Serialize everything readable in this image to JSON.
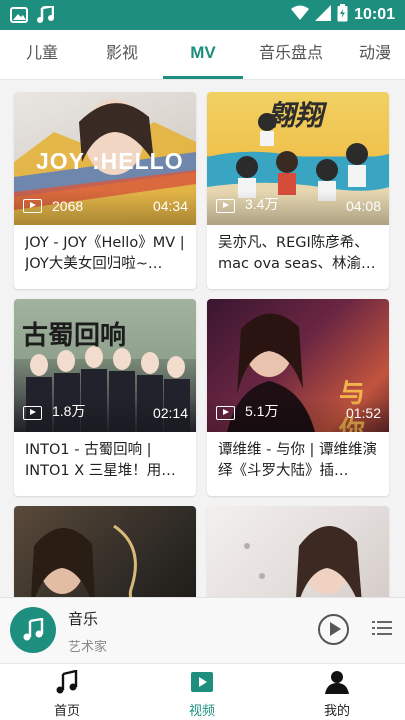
{
  "status_bar": {
    "time": "10:01"
  },
  "tabs": [
    {
      "label": "儿童"
    },
    {
      "label": "影视"
    },
    {
      "label": "MV"
    },
    {
      "label": "音乐盘点"
    },
    {
      "label": "动漫"
    }
  ],
  "active_tab": "MV",
  "videos": [
    {
      "views": "2068",
      "duration": "04:34",
      "title": "JOY - JOY《Hello》MV | JOY大美女回归啦~…",
      "thumb_text": "JOY :HELLO"
    },
    {
      "views": "3.4万",
      "duration": "04:08",
      "title": "吴亦凡、REGI陈彦希、mac ova seas、林渝…",
      "thumb_text": "翱翔"
    },
    {
      "views": "1.8万",
      "duration": "02:14",
      "title": "INTO1 - 古蜀回响 | INTO1 X 三星堆！用…",
      "thumb_text": "古蜀回响"
    },
    {
      "views": "5.1万",
      "duration": "01:52",
      "title": "谭维维 - 与你 | 谭维维演绎《斗罗大陆》插…",
      "thumb_text": "与你"
    },
    {
      "views": "",
      "duration": "",
      "title": "",
      "thumb_text": ""
    },
    {
      "views": "",
      "duration": "",
      "title": "",
      "thumb_text": ""
    }
  ],
  "player": {
    "title": "音乐",
    "artist": "艺术家"
  },
  "bottom_nav": [
    {
      "label": "首页",
      "icon": "music-note-icon"
    },
    {
      "label": "视频",
      "icon": "video-play-icon"
    },
    {
      "label": "我的",
      "icon": "person-icon"
    }
  ],
  "colors": {
    "accent": "#1e8f7f",
    "background": "#f3f3f3"
  }
}
